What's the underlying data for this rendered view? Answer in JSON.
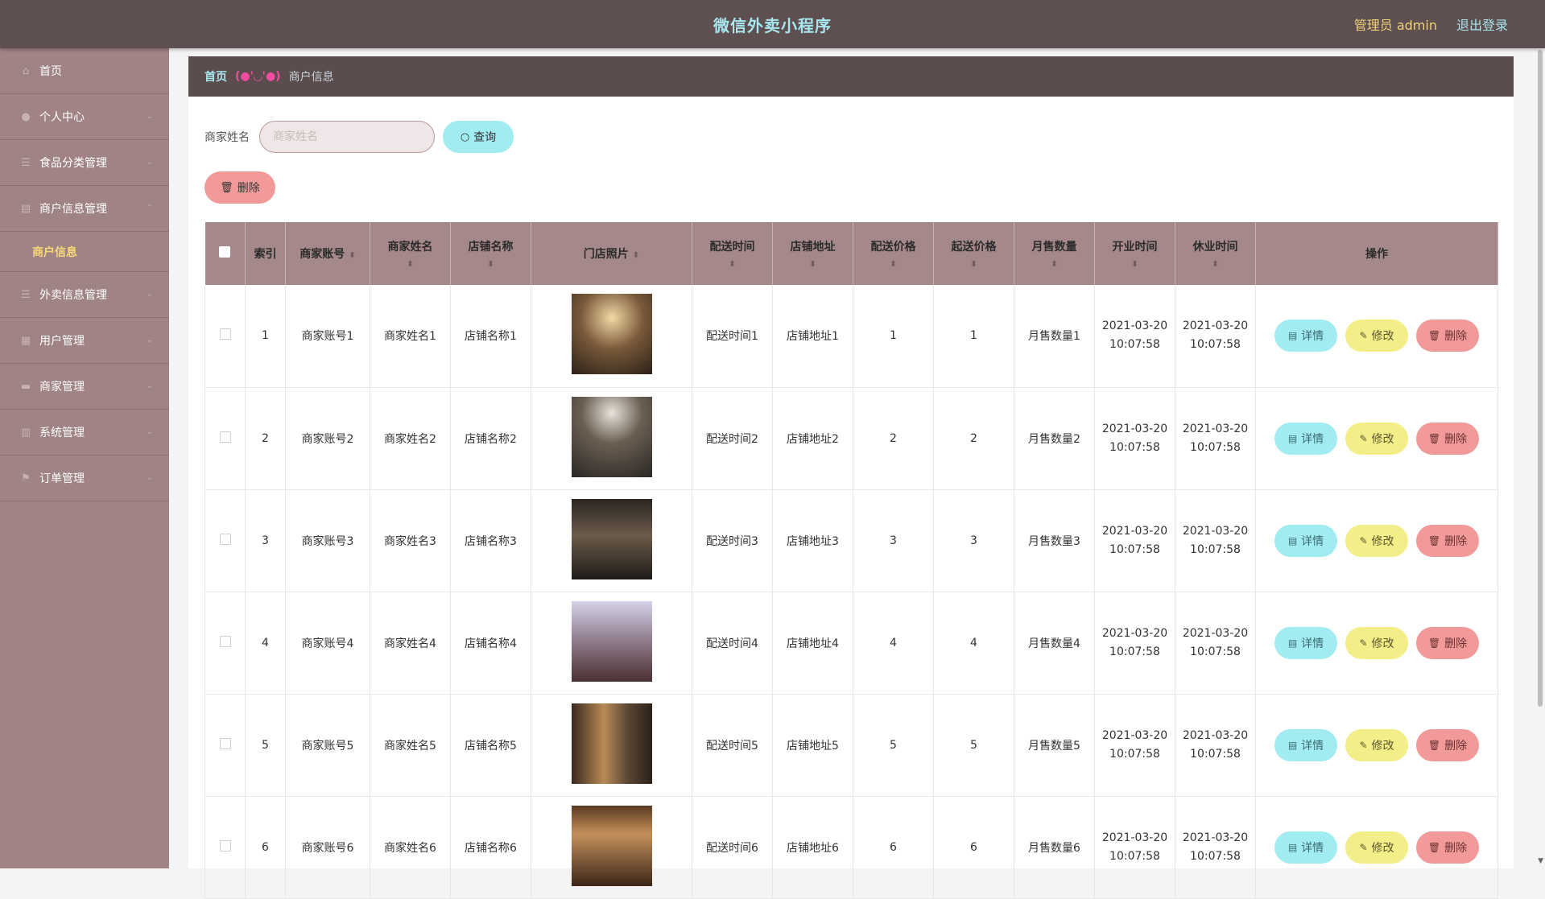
{
  "header": {
    "title": "微信外卖小程序",
    "admin_label": "管理员 admin",
    "logout_label": "退出登录"
  },
  "sidebar": {
    "items": [
      {
        "label": "首页",
        "icon": "home-icon",
        "has_arrow": false
      },
      {
        "label": "个人中心",
        "icon": "user-icon",
        "has_arrow": true
      },
      {
        "label": "食品分类管理",
        "icon": "list-icon",
        "has_arrow": true
      },
      {
        "label": "商户信息管理",
        "icon": "document-icon",
        "has_arrow": true,
        "expanded": true
      },
      {
        "label": "外卖信息管理",
        "icon": "list-icon",
        "has_arrow": true
      },
      {
        "label": "用户管理",
        "icon": "image-icon",
        "has_arrow": true
      },
      {
        "label": "商家管理",
        "icon": "chat-icon",
        "has_arrow": true
      },
      {
        "label": "系统管理",
        "icon": "grid-icon",
        "has_arrow": true
      },
      {
        "label": "订单管理",
        "icon": "flag-icon",
        "has_arrow": true
      }
    ],
    "subitem_active": "商户信息"
  },
  "breadcrumb": {
    "home": "首页",
    "separator": "(●'◡'●)",
    "current": "商户信息"
  },
  "search": {
    "label": "商家姓名",
    "placeholder": "商家姓名",
    "value": "",
    "query_button": "查询"
  },
  "toolbar": {
    "delete_button": "删除"
  },
  "table": {
    "columns": [
      "索引",
      "商家账号",
      "商家姓名",
      "店铺名称",
      "门店照片",
      "配送时间",
      "店铺地址",
      "配送价格",
      "起送价格",
      "月售数量",
      "开业时间",
      "休业时间",
      "操作"
    ],
    "actions": {
      "detail": "详情",
      "edit": "修改",
      "delete": "删除"
    },
    "rows": [
      {
        "index": "1",
        "account": "商家账号1",
        "name": "商家姓名1",
        "shop": "店铺名称1",
        "delivery_time": "配送时间1",
        "address": "店铺地址1",
        "delivery_price": "1",
        "min_price": "1",
        "monthly_sales": "月售数量1",
        "open_date": "2021-03-20",
        "open_time": "10:07:58",
        "close_date": "2021-03-20",
        "close_time": "10:07:58"
      },
      {
        "index": "2",
        "account": "商家账号2",
        "name": "商家姓名2",
        "shop": "店铺名称2",
        "delivery_time": "配送时间2",
        "address": "店铺地址2",
        "delivery_price": "2",
        "min_price": "2",
        "monthly_sales": "月售数量2",
        "open_date": "2021-03-20",
        "open_time": "10:07:58",
        "close_date": "2021-03-20",
        "close_time": "10:07:58"
      },
      {
        "index": "3",
        "account": "商家账号3",
        "name": "商家姓名3",
        "shop": "店铺名称3",
        "delivery_time": "配送时间3",
        "address": "店铺地址3",
        "delivery_price": "3",
        "min_price": "3",
        "monthly_sales": "月售数量3",
        "open_date": "2021-03-20",
        "open_time": "10:07:58",
        "close_date": "2021-03-20",
        "close_time": "10:07:58"
      },
      {
        "index": "4",
        "account": "商家账号4",
        "name": "商家姓名4",
        "shop": "店铺名称4",
        "delivery_time": "配送时间4",
        "address": "店铺地址4",
        "delivery_price": "4",
        "min_price": "4",
        "monthly_sales": "月售数量4",
        "open_date": "2021-03-20",
        "open_time": "10:07:58",
        "close_date": "2021-03-20",
        "close_time": "10:07:58"
      },
      {
        "index": "5",
        "account": "商家账号5",
        "name": "商家姓名5",
        "shop": "店铺名称5",
        "delivery_time": "配送时间5",
        "address": "店铺地址5",
        "delivery_price": "5",
        "min_price": "5",
        "monthly_sales": "月售数量5",
        "open_date": "2021-03-20",
        "open_time": "10:07:58",
        "close_date": "2021-03-20",
        "close_time": "10:07:58"
      },
      {
        "index": "6",
        "account": "商家账号6",
        "name": "商家姓名6",
        "shop": "店铺名称6",
        "delivery_time": "配送时间6",
        "address": "店铺地址6",
        "delivery_price": "6",
        "min_price": "6",
        "monthly_sales": "月售数量6",
        "open_date": "2021-03-20",
        "open_time": "10:07:58",
        "close_date": "2021-03-20",
        "close_time": "10:07:58"
      }
    ]
  },
  "colors": {
    "topbar": "#5e4f50",
    "sidebar": "#a08384",
    "accent_cyan": "#a0ecf0",
    "accent_yellow": "#f2ee88",
    "accent_red": "#f29a9a",
    "table_header": "#a58889"
  }
}
